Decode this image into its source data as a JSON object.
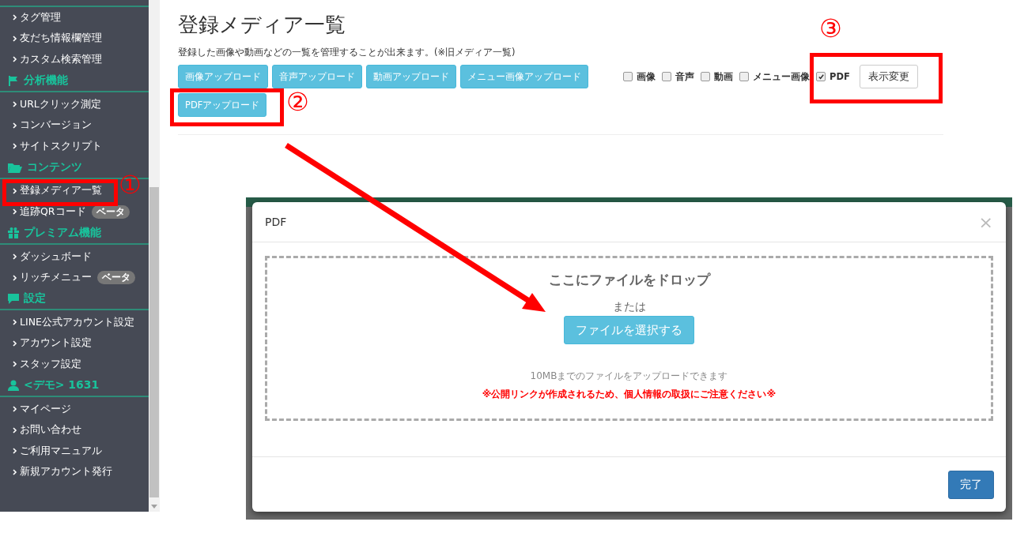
{
  "sidebar": {
    "sections": [
      {
        "items": [
          {
            "label": "タグ管理"
          },
          {
            "label": "友だち情報欄管理"
          },
          {
            "label": "カスタム検索管理"
          }
        ]
      },
      {
        "header": "分析機能",
        "items": [
          {
            "label": "URLクリック測定"
          },
          {
            "label": "コンバージョン"
          },
          {
            "label": "サイトスクリプト"
          }
        ]
      },
      {
        "header": "コンテンツ",
        "items": [
          {
            "label": "登録メディア一覧"
          },
          {
            "label": "追跡QRコード",
            "badge": "ベータ"
          }
        ]
      },
      {
        "header": "プレミアム機能",
        "items": [
          {
            "label": "ダッシュボード"
          },
          {
            "label": "リッチメニュー",
            "badge": "ベータ"
          }
        ]
      },
      {
        "header": "設定",
        "items": [
          {
            "label": "LINE公式アカウント設定"
          },
          {
            "label": "アカウント設定"
          },
          {
            "label": "スタッフ設定"
          }
        ]
      },
      {
        "header": "<デモ> 1631",
        "items": [
          {
            "label": "マイページ"
          },
          {
            "label": "お問い合わせ"
          },
          {
            "label": "ご利用マニュアル"
          },
          {
            "label": "新規アカウント発行"
          }
        ]
      }
    ]
  },
  "page": {
    "title": "登録メディア一覧",
    "description": "登録した画像や動画などの一覧を管理することが出来ます。(※旧メディア一覧)",
    "upload_buttons": [
      "画像アップロード",
      "音声アップロード",
      "動画アップロード",
      "メニュー画像アップロード",
      "PDFアップロード"
    ],
    "filters": [
      {
        "label": "画像",
        "checked": false
      },
      {
        "label": "音声",
        "checked": false
      },
      {
        "label": "動画",
        "checked": false
      },
      {
        "label": "メニュー画像",
        "checked": false
      },
      {
        "label": "PDF",
        "checked": true
      }
    ],
    "apply_button": "表示変更"
  },
  "modal": {
    "title": "PDF",
    "close": "×",
    "drop_text": "ここにファイルをドロップ",
    "or_text": "または",
    "select_button": "ファイルを選択する",
    "limit_text": "10MBまでのファイルをアップロードできます",
    "warning": "※公開リンクが作成されるため、個人情報の取扱にご注意ください※",
    "done_button": "完了"
  },
  "annotations": [
    {
      "number": "①"
    },
    {
      "number": "②"
    },
    {
      "number": "③"
    }
  ]
}
